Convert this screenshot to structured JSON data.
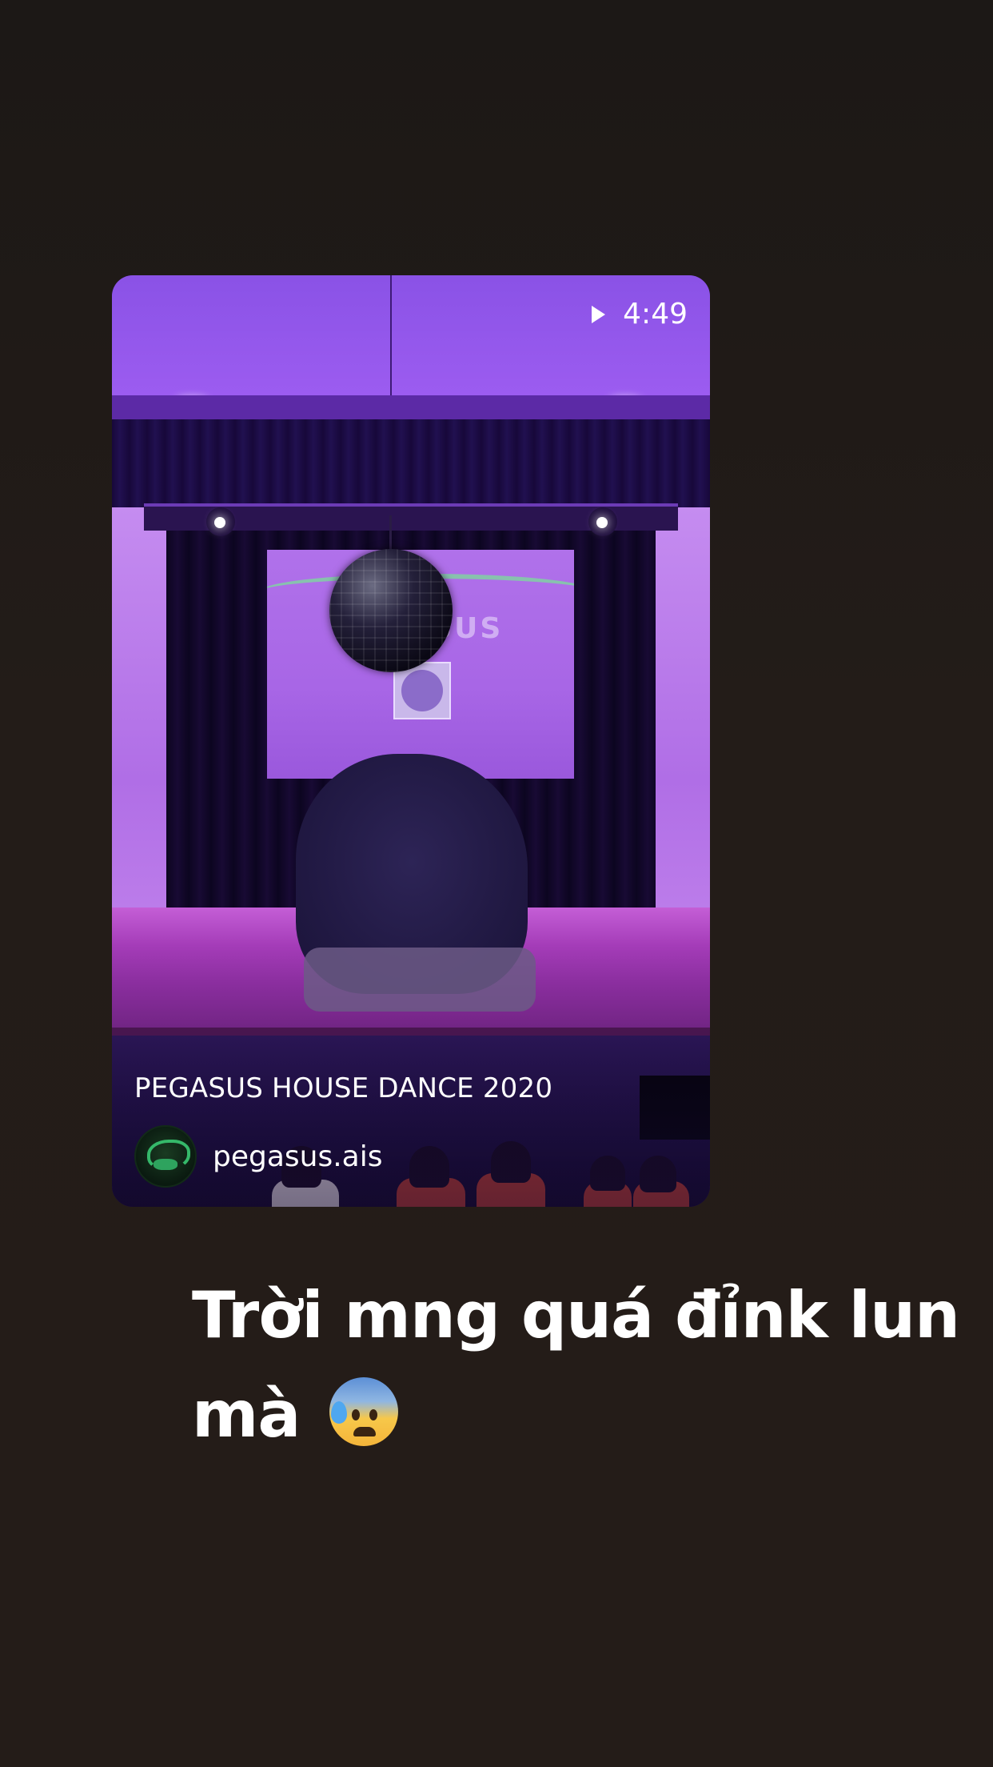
{
  "post": {
    "duration": "4:49",
    "title": "PEGASUS HOUSE DANCE 2020",
    "account": "pegasus.ais",
    "screen_text": "1__ ASUS",
    "icons": {
      "play": "play-icon",
      "avatar": "pegasus-logo-avatar"
    }
  },
  "story": {
    "text": "Trời mng quá đỉnk lun mà",
    "emoji": "anxious-face-with-sweat-emoji"
  },
  "colors": {
    "background": "#241c18",
    "text": "#ffffff",
    "stage_purple": "#9c5cf0"
  }
}
